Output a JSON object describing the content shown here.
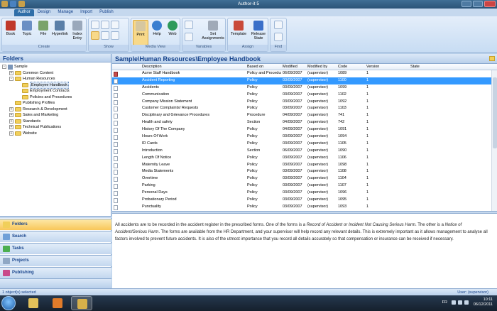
{
  "app": {
    "title": "Author-it 5"
  },
  "ribbon": {
    "tabs": [
      "Author",
      "Design",
      "Manage",
      "Import",
      "Publish"
    ],
    "groups": {
      "create": {
        "label": "Create",
        "buttons": [
          "Book",
          "Topic",
          "File",
          "Hyperlink",
          "Index Entry"
        ]
      },
      "show": {
        "label": "Show"
      },
      "media_view": {
        "label": "Media View",
        "buttons": [
          "Print",
          "Help",
          "Web"
        ]
      },
      "variables": {
        "label": "Variables",
        "buttons": [
          "Set Assignments"
        ]
      },
      "assign": {
        "label": "Assign",
        "buttons": [
          "Template",
          "Release State"
        ]
      },
      "find": {
        "label": "Find"
      }
    }
  },
  "folders": {
    "title": "Folders",
    "tree": [
      {
        "label": "Sample",
        "level": 0,
        "expander": "-"
      },
      {
        "label": "Common Content",
        "level": 1,
        "expander": "+"
      },
      {
        "label": "Human Resources",
        "level": 1,
        "expander": "-"
      },
      {
        "label": "Employee Handbook",
        "level": 2,
        "expander": "",
        "selected": true
      },
      {
        "label": "Employment Contracts",
        "level": 2,
        "expander": ""
      },
      {
        "label": "Policies and Procedures",
        "level": 2,
        "expander": ""
      },
      {
        "label": "Publishing Profiles",
        "level": 1,
        "expander": ""
      },
      {
        "label": "Research & Development",
        "level": 1,
        "expander": "+"
      },
      {
        "label": "Sales and Marketing",
        "level": 1,
        "expander": "+"
      },
      {
        "label": "Standards",
        "level": 1,
        "expander": "+"
      },
      {
        "label": "Technical Publications",
        "level": 1,
        "expander": "+"
      },
      {
        "label": "Website",
        "level": 1,
        "expander": "+"
      }
    ]
  },
  "nav": {
    "buttons": [
      "Folders",
      "Search",
      "Tasks",
      "Projects",
      "Publishing"
    ]
  },
  "main": {
    "breadcrumb": "Sample\\Human Resources\\Employee Handbook",
    "columns": [
      "Description",
      "Based on",
      "Modified",
      "Modified by",
      "Code",
      "Version",
      "State"
    ],
    "rows": [
      {
        "desc": "Acme Staff Handbook",
        "based": "Policy and Procedures",
        "mod": "06/09/2007",
        "by": "(supervisor)",
        "code": "1089",
        "ver": "1",
        "icon": "red"
      },
      {
        "desc": "Accident Reporting",
        "based": "Policy",
        "mod": "03/09/2007",
        "by": "(supervisor)",
        "code": "1100",
        "ver": "1",
        "selected": true
      },
      {
        "desc": "Accidents",
        "based": "Policy",
        "mod": "03/09/2007",
        "by": "(supervisor)",
        "code": "1099",
        "ver": "1"
      },
      {
        "desc": "Communication",
        "based": "Policy",
        "mod": "03/09/2007",
        "by": "(supervisor)",
        "code": "1102",
        "ver": "1"
      },
      {
        "desc": "Company Mission Statement",
        "based": "Policy",
        "mod": "03/09/2007",
        "by": "(supervisor)",
        "code": "1092",
        "ver": "1"
      },
      {
        "desc": "Customer Complaints/ Requests",
        "based": "Policy",
        "mod": "03/09/2007",
        "by": "(supervisor)",
        "code": "1103",
        "ver": "1"
      },
      {
        "desc": "Disciplinary and Grievance Procedures",
        "based": "Procedure",
        "mod": "04/09/2007",
        "by": "(supervisor)",
        "code": "741",
        "ver": "1"
      },
      {
        "desc": "Health and safety",
        "based": "Section",
        "mod": "04/09/2007",
        "by": "(supervisor)",
        "code": "742",
        "ver": "1"
      },
      {
        "desc": "History Of The Company",
        "based": "Policy",
        "mod": "04/09/2007",
        "by": "(supervisor)",
        "code": "1091",
        "ver": "1"
      },
      {
        "desc": "Hours Of Work",
        "based": "Policy",
        "mod": "03/09/2007",
        "by": "(supervisor)",
        "code": "1094",
        "ver": "1"
      },
      {
        "desc": "ID Cards",
        "based": "Policy",
        "mod": "03/09/2007",
        "by": "(supervisor)",
        "code": "1105",
        "ver": "1"
      },
      {
        "desc": "Introduction",
        "based": "Section",
        "mod": "06/09/2007",
        "by": "(supervisor)",
        "code": "1090",
        "ver": "1"
      },
      {
        "desc": "Length Of Notice",
        "based": "Policy",
        "mod": "03/09/2007",
        "by": "(supervisor)",
        "code": "1106",
        "ver": "1"
      },
      {
        "desc": "Maternity Leave",
        "based": "Policy",
        "mod": "03/09/2007",
        "by": "(supervisor)",
        "code": "1098",
        "ver": "1"
      },
      {
        "desc": "Media Statements",
        "based": "Policy",
        "mod": "03/09/2007",
        "by": "(supervisor)",
        "code": "1108",
        "ver": "1"
      },
      {
        "desc": "Overtime",
        "based": "Policy",
        "mod": "03/09/2007",
        "by": "(supervisor)",
        "code": "1104",
        "ver": "1"
      },
      {
        "desc": "Parking",
        "based": "Policy",
        "mod": "03/09/2007",
        "by": "(supervisor)",
        "code": "1107",
        "ver": "1"
      },
      {
        "desc": "Personal Days",
        "based": "Policy",
        "mod": "03/09/2007",
        "by": "(supervisor)",
        "code": "1096",
        "ver": "1"
      },
      {
        "desc": "Probationary Period",
        "based": "Policy",
        "mod": "03/09/2007",
        "by": "(supervisor)",
        "code": "1095",
        "ver": "1"
      },
      {
        "desc": "Punctuality",
        "based": "Policy",
        "mod": "03/09/2007",
        "by": "(supervisor)",
        "code": "1093",
        "ver": "1"
      }
    ],
    "preview": {
      "p1": "All accidents are to be recorded in the accident register in the prescribed forms. One of the forms is a ",
      "i1": "Record of Accident or Incident Not Causing Serious Harm",
      "p2": ". The other is a ",
      "i2": "Notice of Accident/Serious Harm",
      "p3": ". The forms are available from the HR Department, and your supervisor will help record any relevant details. This is extremely important as it allows management to analyse all factors involved to prevent future accidents. It is also of the utmost importance that you record all details accurately so that compensation or insurance can be received if necessary."
    }
  },
  "status": {
    "left": "1 object(s) selected",
    "right": "User: (supervisor)"
  },
  "taskbar": {
    "lang": "FR",
    "time": "10:11",
    "date": "06/12/2011"
  },
  "colors": {
    "accent": "#2f6ea8",
    "selection": "#3399ff",
    "nav_active": "#f8c659"
  }
}
